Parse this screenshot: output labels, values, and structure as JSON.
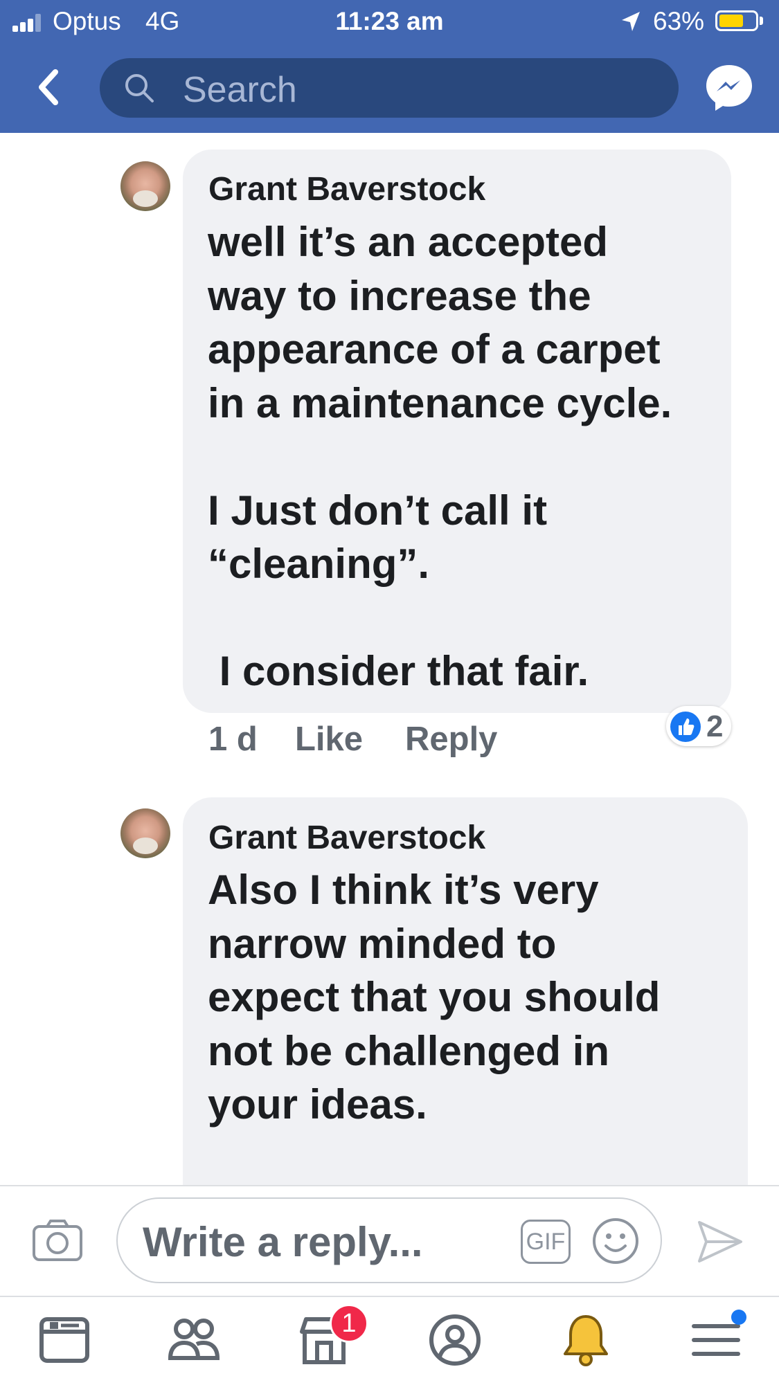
{
  "status_bar": {
    "carrier": "Optus",
    "network": "4G",
    "time": "11:23 am",
    "battery": "63%"
  },
  "header": {
    "search_placeholder": "Search"
  },
  "comments": [
    {
      "author": "Grant Baverstock",
      "text": "well it’s an accepted\nway to increase the\nappearance of a carpet\nin a maintenance cycle.\n\nI Just don’t call it\n“cleaning”.\n\n I consider that fair.",
      "time": "1 d",
      "like_label": "Like",
      "reply_label": "Reply",
      "reaction_count": "2"
    },
    {
      "author": "Grant Baverstock",
      "text": "Also I think it’s very\nnarrow minded to\nexpect that you should\nnot be challenged in\nyour ideas."
    }
  ],
  "composer": {
    "placeholder": "Write a reply...",
    "gif_label": "GIF"
  },
  "tabbar": {
    "marketplace_badge": "1"
  },
  "colors": {
    "brand_blue": "#4267b2",
    "search_bg": "#29487d",
    "bubble_bg": "#f0f1f4",
    "badge_red": "#f02849",
    "bell_gold": "#f5c33b"
  }
}
